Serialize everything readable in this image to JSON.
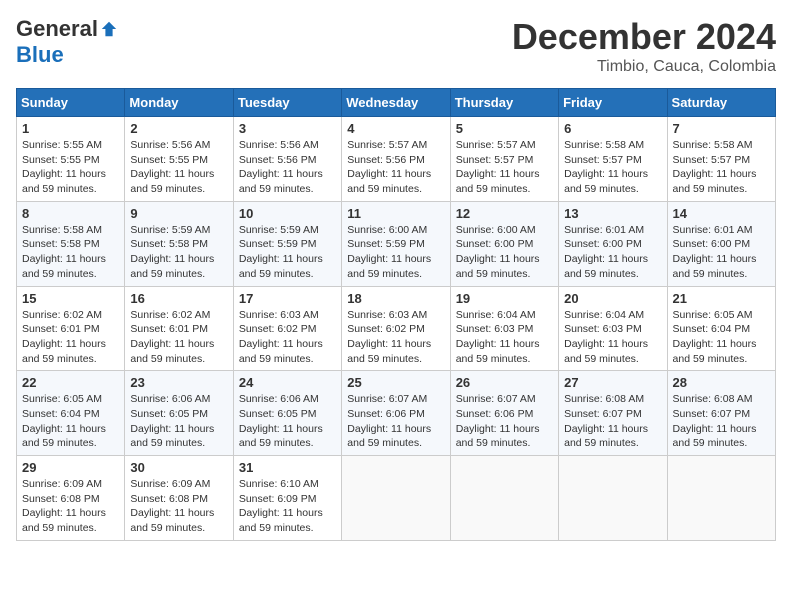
{
  "header": {
    "logo": {
      "general": "General",
      "blue": "Blue"
    },
    "title": "December 2024",
    "location": "Timbio, Cauca, Colombia"
  },
  "calendar": {
    "days_of_week": [
      "Sunday",
      "Monday",
      "Tuesday",
      "Wednesday",
      "Thursday",
      "Friday",
      "Saturday"
    ],
    "weeks": [
      [
        null,
        {
          "day": 2,
          "sunrise": "5:56 AM",
          "sunset": "5:55 PM",
          "daylight": "11 hours and 59 minutes."
        },
        {
          "day": 3,
          "sunrise": "5:56 AM",
          "sunset": "5:56 PM",
          "daylight": "11 hours and 59 minutes."
        },
        {
          "day": 4,
          "sunrise": "5:57 AM",
          "sunset": "5:56 PM",
          "daylight": "11 hours and 59 minutes."
        },
        {
          "day": 5,
          "sunrise": "5:57 AM",
          "sunset": "5:57 PM",
          "daylight": "11 hours and 59 minutes."
        },
        {
          "day": 6,
          "sunrise": "5:58 AM",
          "sunset": "5:57 PM",
          "daylight": "11 hours and 59 minutes."
        },
        {
          "day": 7,
          "sunrise": "5:58 AM",
          "sunset": "5:57 PM",
          "daylight": "11 hours and 59 minutes."
        }
      ],
      [
        {
          "day": 1,
          "sunrise": "5:55 AM",
          "sunset": "5:55 PM",
          "daylight": "11 hours and 59 minutes."
        },
        null,
        null,
        null,
        null,
        null,
        null
      ],
      [
        {
          "day": 8,
          "sunrise": "5:58 AM",
          "sunset": "5:58 PM",
          "daylight": "11 hours and 59 minutes."
        },
        {
          "day": 9,
          "sunrise": "5:59 AM",
          "sunset": "5:58 PM",
          "daylight": "11 hours and 59 minutes."
        },
        {
          "day": 10,
          "sunrise": "5:59 AM",
          "sunset": "5:59 PM",
          "daylight": "11 hours and 59 minutes."
        },
        {
          "day": 11,
          "sunrise": "6:00 AM",
          "sunset": "5:59 PM",
          "daylight": "11 hours and 59 minutes."
        },
        {
          "day": 12,
          "sunrise": "6:00 AM",
          "sunset": "6:00 PM",
          "daylight": "11 hours and 59 minutes."
        },
        {
          "day": 13,
          "sunrise": "6:01 AM",
          "sunset": "6:00 PM",
          "daylight": "11 hours and 59 minutes."
        },
        {
          "day": 14,
          "sunrise": "6:01 AM",
          "sunset": "6:00 PM",
          "daylight": "11 hours and 59 minutes."
        }
      ],
      [
        {
          "day": 15,
          "sunrise": "6:02 AM",
          "sunset": "6:01 PM",
          "daylight": "11 hours and 59 minutes."
        },
        {
          "day": 16,
          "sunrise": "6:02 AM",
          "sunset": "6:01 PM",
          "daylight": "11 hours and 59 minutes."
        },
        {
          "day": 17,
          "sunrise": "6:03 AM",
          "sunset": "6:02 PM",
          "daylight": "11 hours and 59 minutes."
        },
        {
          "day": 18,
          "sunrise": "6:03 AM",
          "sunset": "6:02 PM",
          "daylight": "11 hours and 59 minutes."
        },
        {
          "day": 19,
          "sunrise": "6:04 AM",
          "sunset": "6:03 PM",
          "daylight": "11 hours and 59 minutes."
        },
        {
          "day": 20,
          "sunrise": "6:04 AM",
          "sunset": "6:03 PM",
          "daylight": "11 hours and 59 minutes."
        },
        {
          "day": 21,
          "sunrise": "6:05 AM",
          "sunset": "6:04 PM",
          "daylight": "11 hours and 59 minutes."
        }
      ],
      [
        {
          "day": 22,
          "sunrise": "6:05 AM",
          "sunset": "6:04 PM",
          "daylight": "11 hours and 59 minutes."
        },
        {
          "day": 23,
          "sunrise": "6:06 AM",
          "sunset": "6:05 PM",
          "daylight": "11 hours and 59 minutes."
        },
        {
          "day": 24,
          "sunrise": "6:06 AM",
          "sunset": "6:05 PM",
          "daylight": "11 hours and 59 minutes."
        },
        {
          "day": 25,
          "sunrise": "6:07 AM",
          "sunset": "6:06 PM",
          "daylight": "11 hours and 59 minutes."
        },
        {
          "day": 26,
          "sunrise": "6:07 AM",
          "sunset": "6:06 PM",
          "daylight": "11 hours and 59 minutes."
        },
        {
          "day": 27,
          "sunrise": "6:08 AM",
          "sunset": "6:07 PM",
          "daylight": "11 hours and 59 minutes."
        },
        {
          "day": 28,
          "sunrise": "6:08 AM",
          "sunset": "6:07 PM",
          "daylight": "11 hours and 59 minutes."
        }
      ],
      [
        {
          "day": 29,
          "sunrise": "6:09 AM",
          "sunset": "6:08 PM",
          "daylight": "11 hours and 59 minutes."
        },
        {
          "day": 30,
          "sunrise": "6:09 AM",
          "sunset": "6:08 PM",
          "daylight": "11 hours and 59 minutes."
        },
        {
          "day": 31,
          "sunrise": "6:10 AM",
          "sunset": "6:09 PM",
          "daylight": "11 hours and 59 minutes."
        },
        null,
        null,
        null,
        null
      ]
    ],
    "labels": {
      "sunrise": "Sunrise:",
      "sunset": "Sunset:",
      "daylight": "Daylight:"
    }
  }
}
